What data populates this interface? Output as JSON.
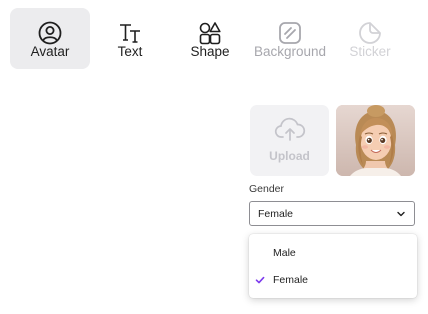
{
  "toolbar": {
    "tabs": [
      {
        "label": "Avatar",
        "icon": "avatar-icon",
        "state": "active"
      },
      {
        "label": "Text",
        "icon": "text-icon",
        "state": "normal"
      },
      {
        "label": "Shape",
        "icon": "shape-icon",
        "state": "normal"
      },
      {
        "label": "Background",
        "icon": "background-icon",
        "state": "disabled"
      },
      {
        "label": "Sticker",
        "icon": "sticker-icon",
        "state": "faded"
      }
    ]
  },
  "panel": {
    "upload_label": "Upload",
    "upload_icon": "cloud-upload-icon",
    "avatar_image": "avatar-thumbnail",
    "gender_label": "Gender",
    "gender_value": "Female",
    "gender_options": [
      {
        "label": "Male",
        "selected": false
      },
      {
        "label": "Female",
        "selected": true
      }
    ]
  },
  "colors": {
    "active_tab_bg": "#ececee",
    "check_accent": "#7c3aed",
    "disabled_text": "#a7a7ad"
  }
}
